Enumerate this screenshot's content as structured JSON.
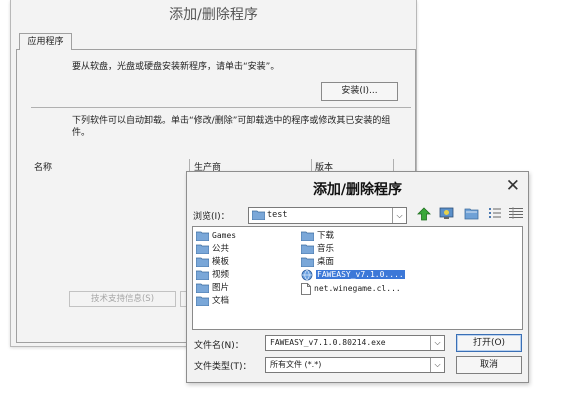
{
  "background_window": {
    "title": "添加/删除程序",
    "tab": "应用程序",
    "install_text": "要从软盘，光盘或硬盘安装新程序，请单击“安装”。",
    "install_button": "安装(I)...",
    "uninstall_text": "下列软件可以自动卸载。单击“修改/删除”可卸载选中的程序或修改其已安装的组件。",
    "columns": [
      "名称",
      "生产商",
      "版本"
    ],
    "support_button": "技术支持信息(S)"
  },
  "dialog": {
    "title": "添加/删除程序",
    "look_in_label": "浏览(I)：",
    "current_folder": "test",
    "left_items": [
      "Games",
      "公共",
      "模板",
      "视频",
      "图片",
      "文档"
    ],
    "right_items": [
      "下载",
      "音乐",
      "桌面"
    ],
    "files": [
      "FAWEASY_v7.1.0....",
      "net.winegame.cl..."
    ],
    "file_name_label": "文件名(N)：",
    "file_name_value": "FAWEASY_v7.1.0.80214.exe",
    "file_type_label": "文件类型(T)：",
    "file_type_value": "所有文件 (*.*)",
    "open_button": "打开(O)",
    "cancel_button": "取消"
  }
}
